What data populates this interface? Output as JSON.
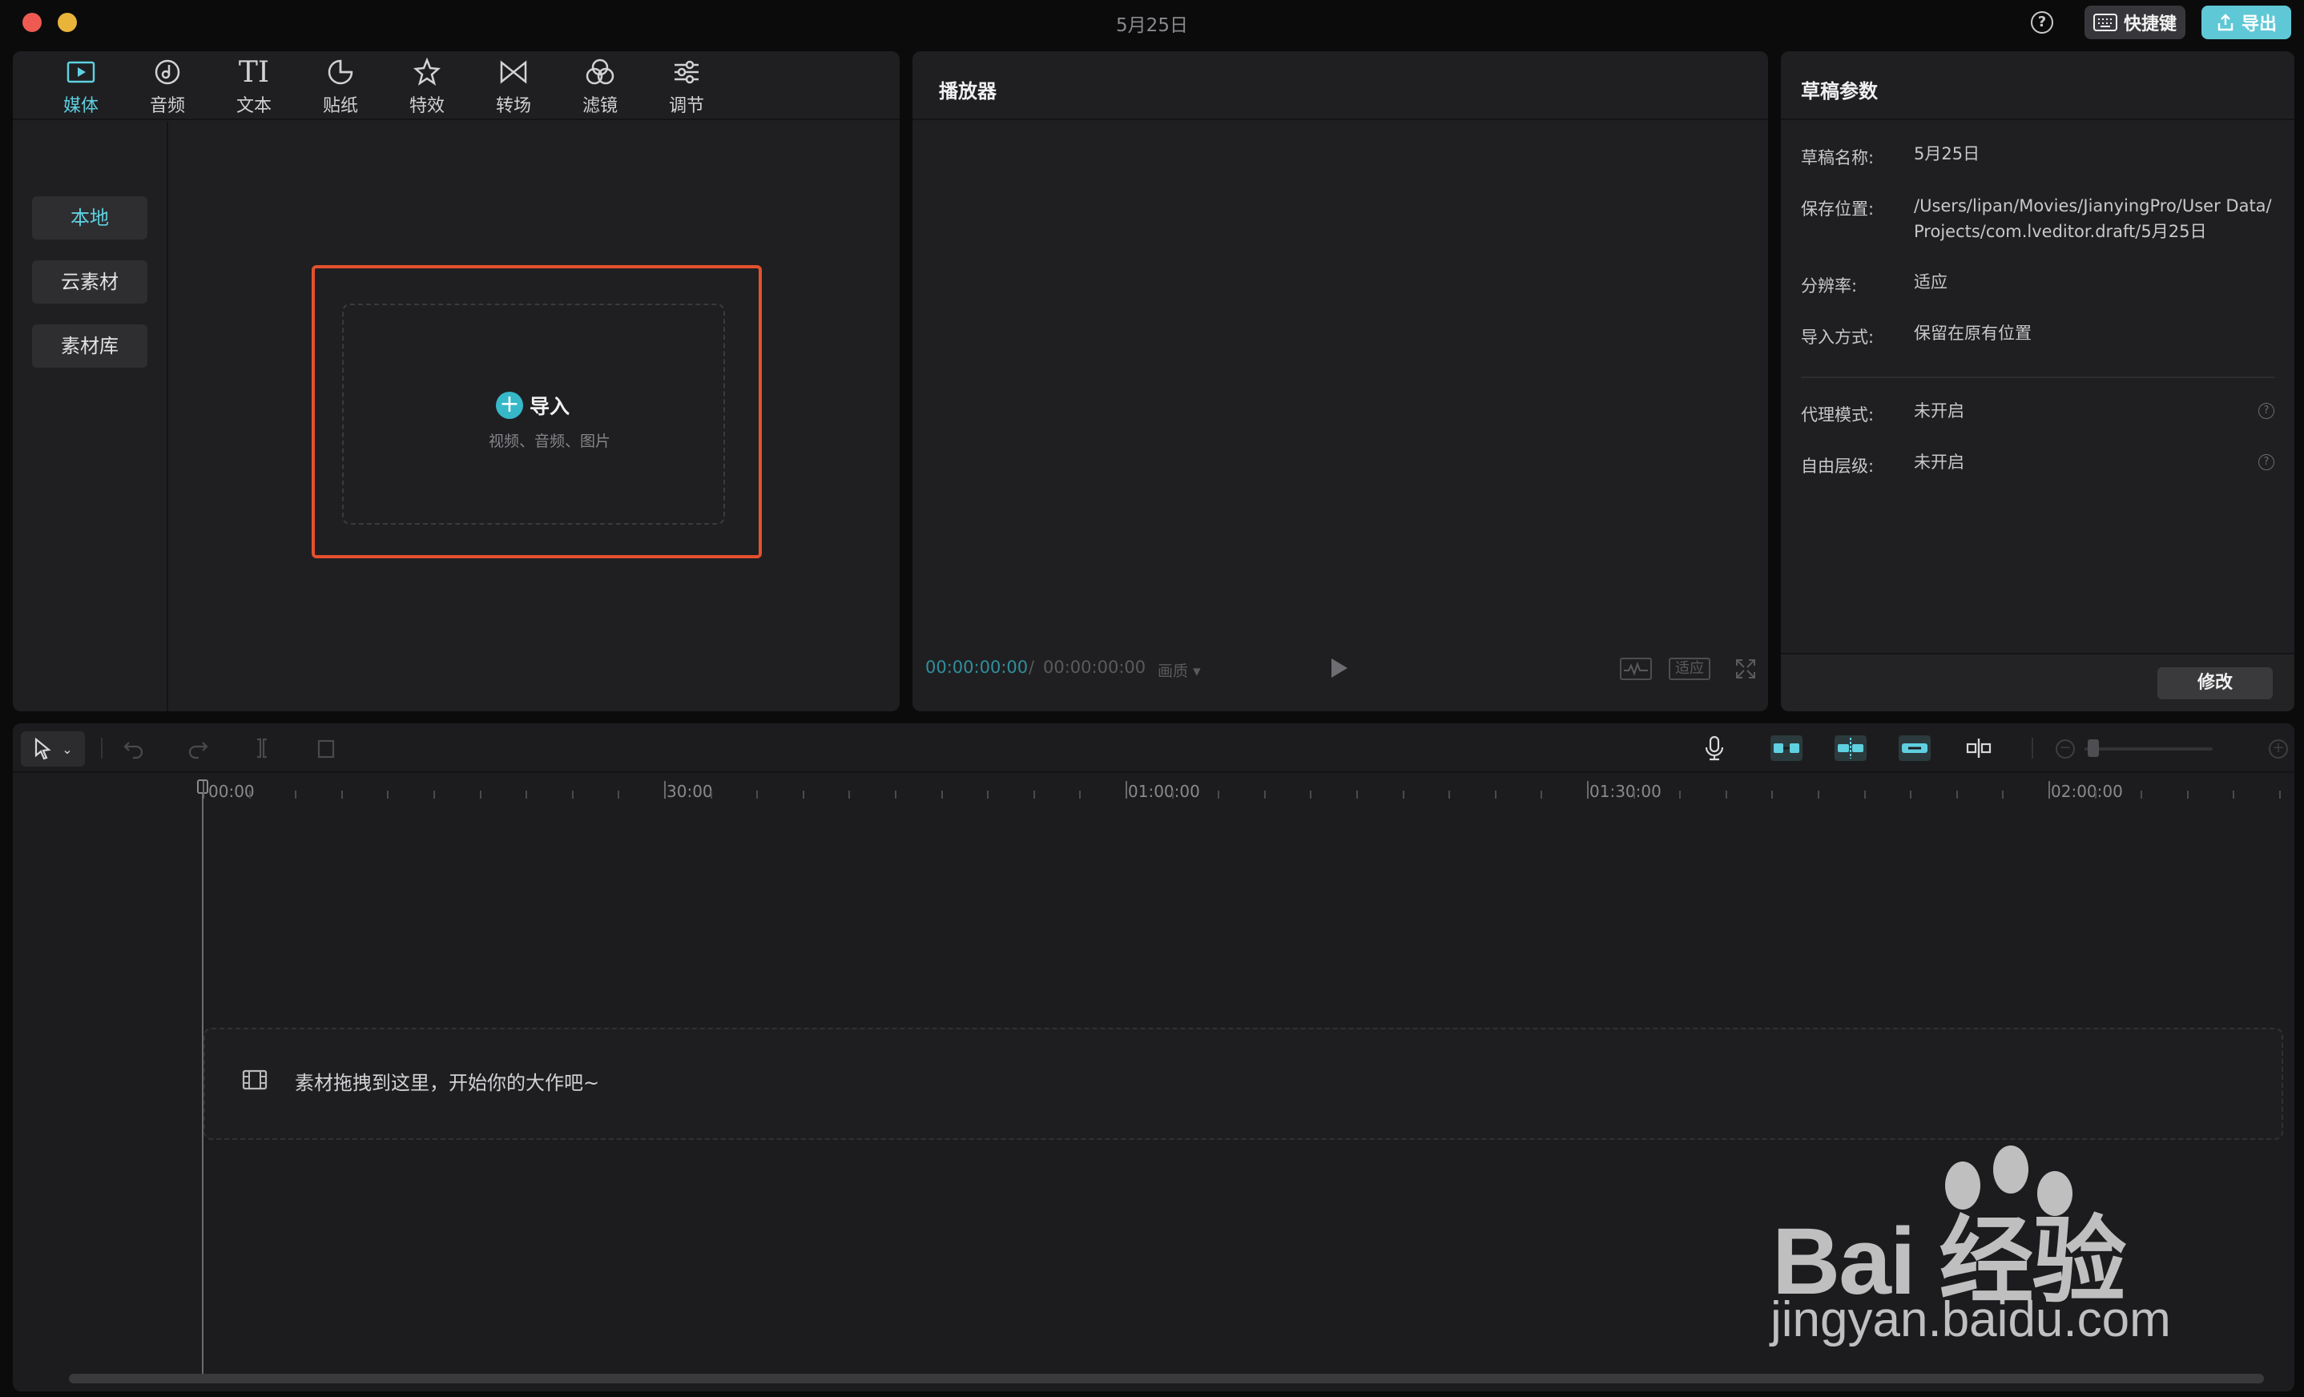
{
  "window": {
    "title": "5月25日"
  },
  "header": {
    "help_icon": "question-circle-icon",
    "shortcut_label": "快捷键",
    "export_label": "导出",
    "accent": "#5fc8d6"
  },
  "media": {
    "tabs": [
      {
        "label": "媒体",
        "icon": "media-play-icon",
        "active": true
      },
      {
        "label": "音频",
        "icon": "music-note-icon"
      },
      {
        "label": "文本",
        "icon": "text-ti-icon"
      },
      {
        "label": "贴纸",
        "icon": "sticker-icon"
      },
      {
        "label": "特效",
        "icon": "effect-star-icon"
      },
      {
        "label": "转场",
        "icon": "transition-bowtie-icon"
      },
      {
        "label": "滤镜",
        "icon": "filter-circles-icon"
      },
      {
        "label": "调节",
        "icon": "adjust-sliders-icon"
      }
    ],
    "sidebar": [
      "本地",
      "云素材",
      "素材库"
    ],
    "import": {
      "label": "导入",
      "sub": "视频、音频、图片",
      "highlight_color": "#e4502e"
    }
  },
  "player": {
    "title": "播放器",
    "current_time": "00:00:00:00",
    "separator": "/",
    "total_time": "00:00:00:00",
    "quality": "画质",
    "fit_label": "适应"
  },
  "draft": {
    "title": "草稿参数",
    "params": [
      {
        "label": "草稿名称:",
        "value": "5月25日"
      },
      {
        "label": "保存位置:",
        "value": "/Users/lipan/Movies/JianyingPro/User Data/Projects/com.lveditor.draft/5月25日"
      },
      {
        "label": "分辨率:",
        "value": "适应"
      },
      {
        "label": "导入方式:",
        "value": "保留在原有位置"
      },
      {
        "label": "代理模式:",
        "value": "未开启"
      },
      {
        "label": "自由层级:",
        "value": "未开启"
      }
    ],
    "modify_label": "修改"
  },
  "timeline": {
    "ruler_labels": [
      "00:00",
      "30:00",
      "01:00:00",
      "01:30:00",
      "02:00:00"
    ],
    "drop_hint": "素材拖拽到这里，开始你的大作吧~"
  },
  "watermark": {
    "brand": "Bai 经验",
    "url": "jingyan.baidu.com"
  }
}
